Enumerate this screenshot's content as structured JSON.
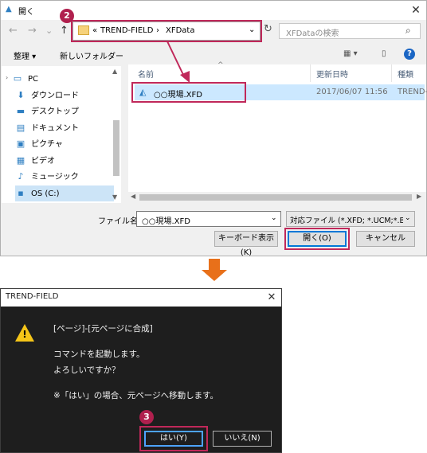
{
  "open_dialog": {
    "title": "開く",
    "close_glyph": "✕",
    "nav": {
      "back": "←",
      "forward": "→",
      "dropdown": "⌄",
      "up": "↑"
    },
    "breadcrumb": {
      "overflow": "«",
      "items": [
        "TREND-FIELD",
        "XFData"
      ],
      "separator": "›"
    },
    "search_placeholder": "XFDataの検索",
    "toolbar": {
      "organize": "整理 ▾",
      "new_folder": "新しいフォルダー",
      "help": "?"
    },
    "sidebar": [
      {
        "label": "PC",
        "icon": "pc-icon",
        "glyph": "▭"
      },
      {
        "label": "ダウンロード",
        "icon": "download-icon",
        "glyph": "⬇"
      },
      {
        "label": "デスクトップ",
        "icon": "desktop-icon",
        "glyph": "▬"
      },
      {
        "label": "ドキュメント",
        "icon": "documents-icon",
        "glyph": "▤"
      },
      {
        "label": "ピクチャ",
        "icon": "pictures-icon",
        "glyph": "▣"
      },
      {
        "label": "ビデオ",
        "icon": "videos-icon",
        "glyph": "▦"
      },
      {
        "label": "ミュージック",
        "icon": "music-icon",
        "glyph": "♪"
      },
      {
        "label": "OS (C:)",
        "icon": "drive-icon",
        "glyph": "▪"
      }
    ],
    "columns": [
      "名前",
      "更新日時",
      "種類"
    ],
    "files": [
      {
        "name": "○○現場.XFD",
        "modified": "2017/06/07 11:56",
        "type": "TREND-"
      }
    ],
    "filename_label": "ファイル名(N):",
    "filename_value": "○○現場.XFD",
    "filter_value": "対応ファイル (*.XFD; *.UCM;*.BDM",
    "buttons": {
      "keyboard": "キーボード表示(K)",
      "open": "開く(O)",
      "cancel": "キャンセル"
    }
  },
  "confirm_dialog": {
    "title": "TREND-FIELD",
    "close_glyph": "✕",
    "line1": "[ページ]-[元ページに合成]",
    "line2": "コマンドを起動します。",
    "line3": "よろしいですか？",
    "line4": "※「はい」の場合、元ページへ移動します。",
    "yes": "はい(Y)",
    "no": "いいえ(N)"
  },
  "callouts": {
    "step2": "2",
    "step3": "3"
  },
  "colors": {
    "highlight": "#c0285a",
    "arrow": "#e8701a",
    "selection": "#cce8ff"
  }
}
